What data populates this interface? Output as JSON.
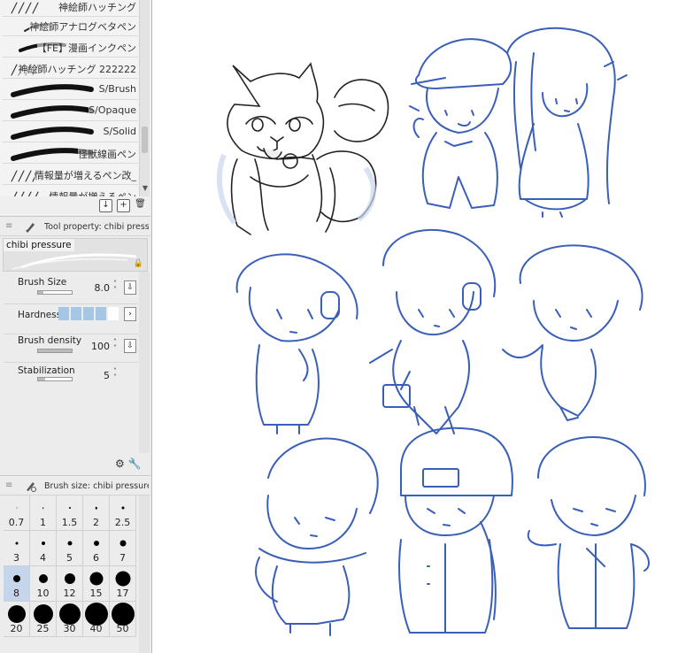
{
  "brush_list": {
    "items": [
      {
        "name": "神絵師ハッチング",
        "stroke": "hatch"
      },
      {
        "name": "神絵師アナログベタペン",
        "stroke": "thin"
      },
      {
        "name": "【FE】漫画インクペン",
        "stroke": "ink"
      },
      {
        "name": "神絵師ハッチング 222222",
        "stroke": "hatch"
      },
      {
        "name": "S/Brush",
        "stroke": "bold"
      },
      {
        "name": "S/Opaque",
        "stroke": "bold"
      },
      {
        "name": "S/Solid",
        "stroke": "bold"
      },
      {
        "name": "怪獣線画ペン",
        "stroke": "bold"
      },
      {
        "name": "情報量が増えるペン改_",
        "stroke": "hatch"
      },
      {
        "name": "情報量が増えるペン",
        "stroke": "hatch"
      }
    ],
    "actions": [
      {
        "icon": "save-icon",
        "glyph": "↓"
      },
      {
        "icon": "duplicate-icon",
        "glyph": "+"
      },
      {
        "icon": "trash-icon",
        "glyph": "🗑"
      }
    ]
  },
  "tool_property": {
    "grip": "≡",
    "title": "Tool property: chibi pressure",
    "preview_label": "chibi pressure",
    "lock_glyph": "🔒",
    "brush_size": {
      "label": "Brush Size",
      "value": "8.0"
    },
    "hardness": {
      "label": "Hardness",
      "level": 4,
      "max": 5
    },
    "brush_density": {
      "label": "Brush density",
      "value": "100"
    },
    "stabilization": {
      "label": "Stabilization",
      "value": "5"
    }
  },
  "brush_size_panel": {
    "grip": "≡",
    "title": "Brush size: chibi pressure",
    "selected": "8",
    "sizes": [
      "0.7",
      "1",
      "1.5",
      "2",
      "2.5",
      "3",
      "4",
      "5",
      "6",
      "7",
      "8",
      "10",
      "12",
      "15",
      "17",
      "20",
      "25",
      "30",
      "40",
      "50"
    ]
  },
  "colors": {
    "sketch": "#3a5fb8",
    "selected_cell": "#c6d6ea",
    "hardness_fill": "#a6c6e6"
  }
}
